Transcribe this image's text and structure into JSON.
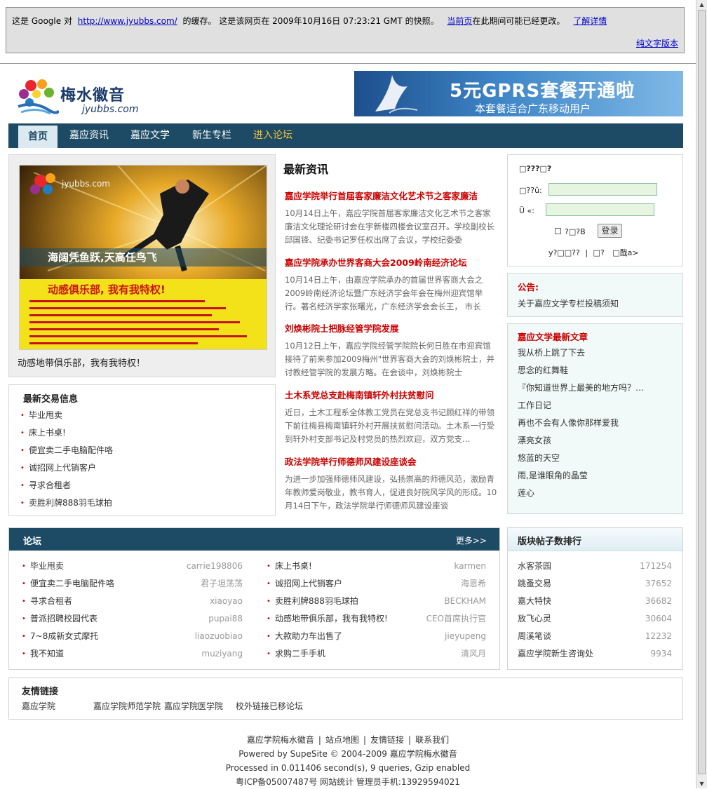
{
  "cache_banner": {
    "prefix": "这是 Google 对",
    "url": "http://www.jyubbs.com/",
    "middle": "的缓存。 这是该网页在 2009年10月16日 07:23:21 GMT 的快照。",
    "current_page_link": "当前页",
    "suffix": "在此期间可能已经更改。",
    "learn_more_link": "了解详情",
    "text_only_link": "纯文字版本"
  },
  "logo": {
    "name": "梅水徽音",
    "domain": "jyubbs.com"
  },
  "ad": {
    "title": "5元GPRS套餐开通啦",
    "subtitle": "本套餐适合广东移动用户"
  },
  "nav": {
    "items": [
      {
        "label": "首页",
        "active": true
      },
      {
        "label": "嘉应资讯"
      },
      {
        "label": "嘉应文学"
      },
      {
        "label": "新生专栏"
      },
      {
        "label": "进入论坛",
        "highlight": "#f0c040"
      }
    ]
  },
  "promo": {
    "poster_headline": "海阔凭鱼跃,天高任鸟飞",
    "poster_slogan": "动感俱乐部, 我有我特权!",
    "caption": "动感地带俱乐部，我有我特权！"
  },
  "trade": {
    "title": "最新交易信息",
    "items": [
      "毕业甩卖",
      "床上书桌!",
      "便宜卖二手电脑配件咯",
      "诚招网上代销客户",
      "寻求合租者",
      "卖胜利牌888羽毛球拍"
    ]
  },
  "news": {
    "title": "最新资讯",
    "items": [
      {
        "headline": "嘉应学院举行首届客家廉洁文化艺术节之客家廉洁",
        "summary": "10月14日上午，嘉应学院首届客家廉洁文化艺术节之客家廉洁文化理论研讨会在宇新楼四楼会议室召开。学校副校长邱国锋、纪委书记罗任权出席了会议，学校纪委委"
      },
      {
        "headline": "嘉应学院承办世界客商大会2009岭南经济论坛",
        "summary": "10月14日上午，由嘉应学院承办的首届世界客商大会之2009岭南经济论坛暨广东经济学会年会在梅州迎宾馆举行。著名经济学家张曙光，广东经济学会会长王， 市长"
      },
      {
        "headline": "刘焕彬院士把脉经管学院发展",
        "summary": "10月12日上午，嘉应学院经管学院院长何日胜在市迎宾馆接待了前来参加2009梅州\"世界客商大会的刘焕彬院士，并讨教经管学院的发展方略。在会谈中，刘焕彬院士"
      },
      {
        "headline": "土木系党总支赴梅南镇轩外村扶贫慰问",
        "summary": "近日，土木工程系全体教工党员在党总支书记顾红祥的带领下前往梅县梅南镇轩外村开展扶贫慰问活动。土木系一行受到轩外村支部书记及村党员的热烈欢迎，双方党支…"
      },
      {
        "headline": "政法学院举行师德师风建设座谈会",
        "summary": "为进一步加强师德师风建设，弘扬崇高的师德风范，激励青年教师爱岗敬业，教书育人，促进良好院风学风的形成。10月14日下午，政法学院举行师德师风建设座谈"
      }
    ]
  },
  "login": {
    "title": "□???□?",
    "username_label": "□??û:",
    "password_label": "Ü «:",
    "remember_label": "?□?B",
    "submit_label": "登录",
    "register_link": "у?□□??",
    "divider": "|",
    "help_link": "□?",
    "forgot_link": "□䣬a>"
  },
  "notice": {
    "title": "公告:",
    "text": "关于嘉应文学专栏投稿须知"
  },
  "articles": {
    "title": "嘉应文学最新文章",
    "items": [
      "我从桥上跳了下去",
      "思念的红舞鞋",
      "『你知道世界上最美的地方吗？…",
      "工作日记",
      "再也不会有人像你那样爱我",
      "漂亮女孩",
      "悠蓝的天空",
      "雨,是谁眼角的晶莹",
      "莲心"
    ]
  },
  "forum": {
    "title": "论坛",
    "more": "更多>>",
    "left": [
      {
        "title": "毕业甩卖",
        "user": "carrie198806"
      },
      {
        "title": "便宜卖二手电脑配件咯",
        "user": "君子坦荡荡"
      },
      {
        "title": "寻求合租者",
        "user": "xiaoyao"
      },
      {
        "title": "普派招聘校园代表",
        "user": "pupai88"
      },
      {
        "title": "7~8成新女式摩托",
        "user": "liaozuobiao"
      },
      {
        "title": "我不知道",
        "user": "muziyang"
      }
    ],
    "right": [
      {
        "title": "床上书桌!",
        "user": "karmen"
      },
      {
        "title": "诚招网上代销客户",
        "user": "海恩希"
      },
      {
        "title": "卖胜利牌888羽毛球拍",
        "user": "BECKHAM"
      },
      {
        "title": "动感地带俱乐部，我有我特权!",
        "user": "CEO首席执行官"
      },
      {
        "title": "大款助力车出售了",
        "user": "jieyupeng"
      },
      {
        "title": "求购二手手机",
        "user": "清风月"
      }
    ]
  },
  "ranking": {
    "title": "版块帖子数排行",
    "items": [
      {
        "name": "水客茶园",
        "count": "171254"
      },
      {
        "name": "跳蚤交易",
        "count": "37652"
      },
      {
        "name": "嘉大特快",
        "count": "36682"
      },
      {
        "name": "放飞心灵",
        "count": "30604"
      },
      {
        "name": "周溪笔谈",
        "count": "12232"
      },
      {
        "name": "嘉应学院新生咨询处",
        "count": "9934"
      }
    ]
  },
  "links": {
    "title": "友情链接",
    "items": [
      "嘉应学院",
      "嘉应学院师范学院",
      "嘉应学院医学院",
      "校外链接已移论坛"
    ]
  },
  "footer": {
    "links": [
      "嘉应学院梅水徽音",
      "站点地图",
      "友情链接",
      "联系我们"
    ],
    "separator": "|",
    "powered": "Powered by SupeSite © 2004-2009 嘉应学院梅水徽音",
    "processed": "Processed in 0.011406 second(s), 9 queries, Gzip enabled",
    "icp": "粤ICP备05007487号 网站统计 管理员手机:13929594021"
  },
  "colors": {
    "nav_bg": "#1d4a64",
    "headline_red": "#cc0000",
    "link_blue": "#0000cc",
    "panel_tint": "#f1faf8"
  }
}
